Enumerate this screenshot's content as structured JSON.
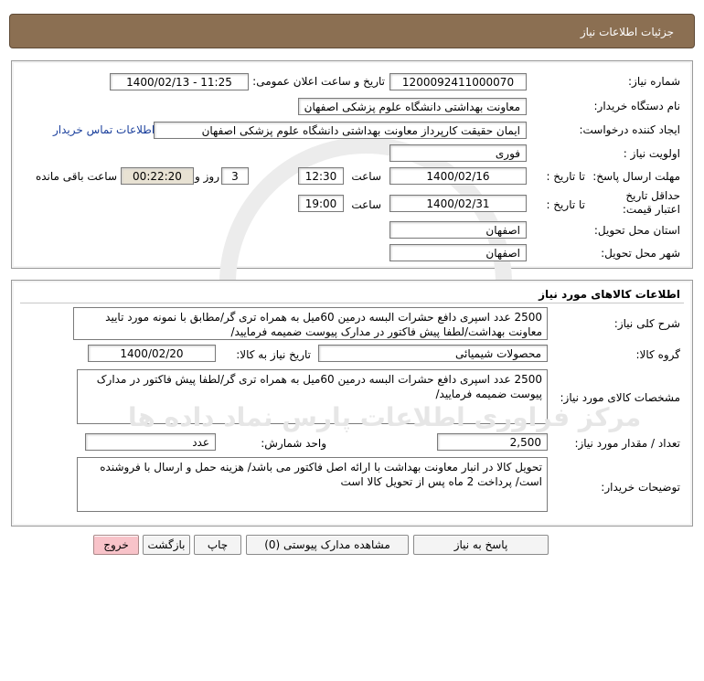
{
  "header": {
    "title": "جزئیات اطلاعات نیاز"
  },
  "info": {
    "need_number_label": "شماره نیاز:",
    "need_number": "1200092411000070",
    "announce_label": "تاریخ و ساعت اعلان عمومی:",
    "announce_value": "1400/02/13 - 11:25",
    "buyer_org_label": "نام دستگاه خریدار:",
    "buyer_org": "معاونت بهداشتی دانشگاه علوم پزشکی اصفهان",
    "creator_label": "ایجاد کننده درخواست:",
    "creator": "ایمان حقیقت کارپرداز معاونت بهداشتی دانشگاه علوم پزشکی اصفهان",
    "contact_link": "اطلاعات تماس خریدار",
    "priority_label": "اولویت نیاز :",
    "priority": "فوری",
    "deadline_label": "مهلت ارسال پاسخ:",
    "to_date_label": "تا تاریخ :",
    "deadline_date": "1400/02/16",
    "time_label": "ساعت",
    "deadline_time": "12:30",
    "days_value": "3",
    "days_label": "روز و",
    "remaining_time": "00:22:20",
    "remaining_label": "ساعت باقی مانده",
    "validity_label": "حداقل تاریخ اعتبار قیمت:",
    "validity_to_label": "تا تاریخ :",
    "validity_date": "1400/02/31",
    "validity_time_label": "ساعت",
    "validity_time": "19:00",
    "province_label": "استان محل تحویل:",
    "province": "اصفهان",
    "city_label": "شهر محل تحویل:",
    "city": "اصفهان"
  },
  "goods": {
    "section_title": "اطلاعات کالاهای مورد نیاز",
    "summary_label": "شرح کلی نیاز:",
    "summary": "2500 عدد اسپری دافع حشرات البسه درمین 60میل به همراه تری گر/مطابق با نمونه مورد تایید معاونت بهداشت/لطفا پیش فاکتور در مدارک پیوست ضمیمه فرمایید/",
    "group_label": "گروه کالا:",
    "group": "محصولات شیمیائی",
    "need_date_label": "تاریخ نیاز به کالا:",
    "need_date": "1400/02/20",
    "spec_label": "مشخصات کالای مورد نیاز:",
    "spec": "2500 عدد اسپری دافع حشرات البسه درمین 60میل به همراه تری گر/لطفا پیش فاکتور در مدارک پیوست ضمیمه فرمایید/",
    "qty_label": "تعداد / مقدار مورد نیاز:",
    "qty": "2,500",
    "unit_label": "واحد شمارش:",
    "unit": "عدد",
    "notes_label": "توضیحات خریدار:",
    "notes": "تحویل کالا در انبار معاونت بهداشت با ارائه اصل فاکتور می باشد/ هزینه حمل و ارسال با فروشنده است/ پرداخت 2 ماه پس از تحویل کالا است"
  },
  "buttons": {
    "reply": "پاسخ به نیاز",
    "attachments": "مشاهده مدارک پیوستی (0)",
    "print": "چاپ",
    "back": "بازگشت",
    "exit": "خروج"
  },
  "colors": {
    "header_bg": "#8b6f52",
    "exit_button_bg": "#f8c3c9",
    "link": "#1a3f9c",
    "remaining_bg": "#e8e2d3"
  }
}
